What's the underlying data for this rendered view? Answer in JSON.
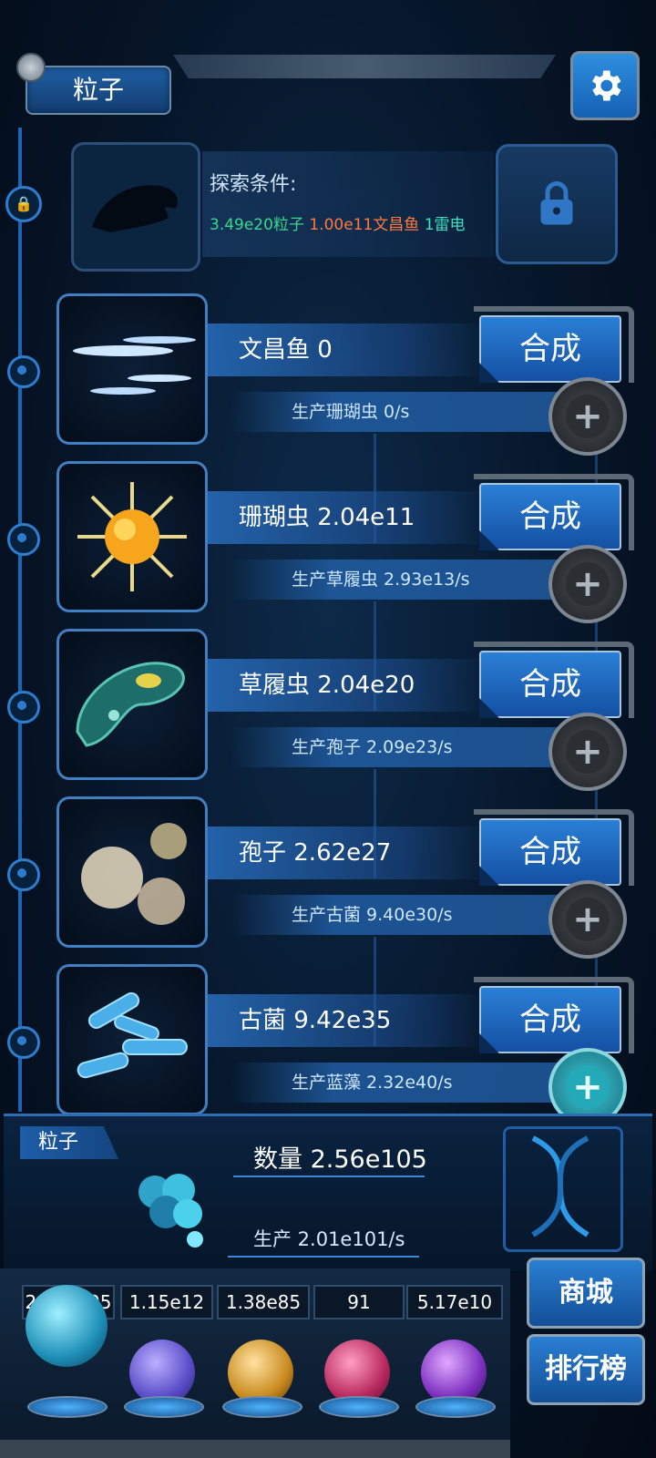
{
  "header": {
    "title": "粒子"
  },
  "locked": {
    "condition_label": "探索条件:",
    "req_particles": "3.49e20粒子",
    "req_fish": "1.00e11文昌鱼",
    "req_thunder": "1雷电"
  },
  "creatures": [
    {
      "name": "文昌鱼 0",
      "production": "生产珊瑚虫 0/s",
      "synth_label": "合成",
      "icon": "fish-icon"
    },
    {
      "name": "珊瑚虫 2.04e11",
      "production": "生产草履虫 2.93e13/s",
      "synth_label": "合成",
      "icon": "coral-polyp-icon"
    },
    {
      "name": "草履虫 2.04e20",
      "production": "生产孢子 2.09e23/s",
      "synth_label": "合成",
      "icon": "paramecium-icon"
    },
    {
      "name": "孢子 2.62e27",
      "production": "生产古菌 9.40e30/s",
      "synth_label": "合成",
      "icon": "spore-icon"
    },
    {
      "name": "古菌 9.42e35",
      "production": "生产蓝藻 2.32e40/s",
      "synth_label": "合成",
      "icon": "archaea-icon"
    }
  ],
  "panel": {
    "tag": "粒子",
    "count": "数量 2.56e105",
    "production": "生产 2.01e101/s"
  },
  "resources": [
    {
      "value": "2.56e105",
      "icon": "particle-orb-icon",
      "color": "#3fb6d8"
    },
    {
      "value": "1.15e12",
      "icon": "lightning-orb-icon",
      "color": "#6a5bd1"
    },
    {
      "value": "1.38e85",
      "icon": "nebula-orb-icon",
      "color": "#d89a2e"
    },
    {
      "value": "91",
      "icon": "brain-orb-icon",
      "color": "#c23b6d"
    },
    {
      "value": "5.17e10",
      "icon": "vortex-orb-icon",
      "color": "#8a3cc9"
    }
  ],
  "side": {
    "shop_label": "商城",
    "rank_label": "排行榜"
  },
  "colors": {
    "cond_green": "#39d98a",
    "cond_orange": "#ff7a3c",
    "cond_teal": "#3ee0c0"
  }
}
